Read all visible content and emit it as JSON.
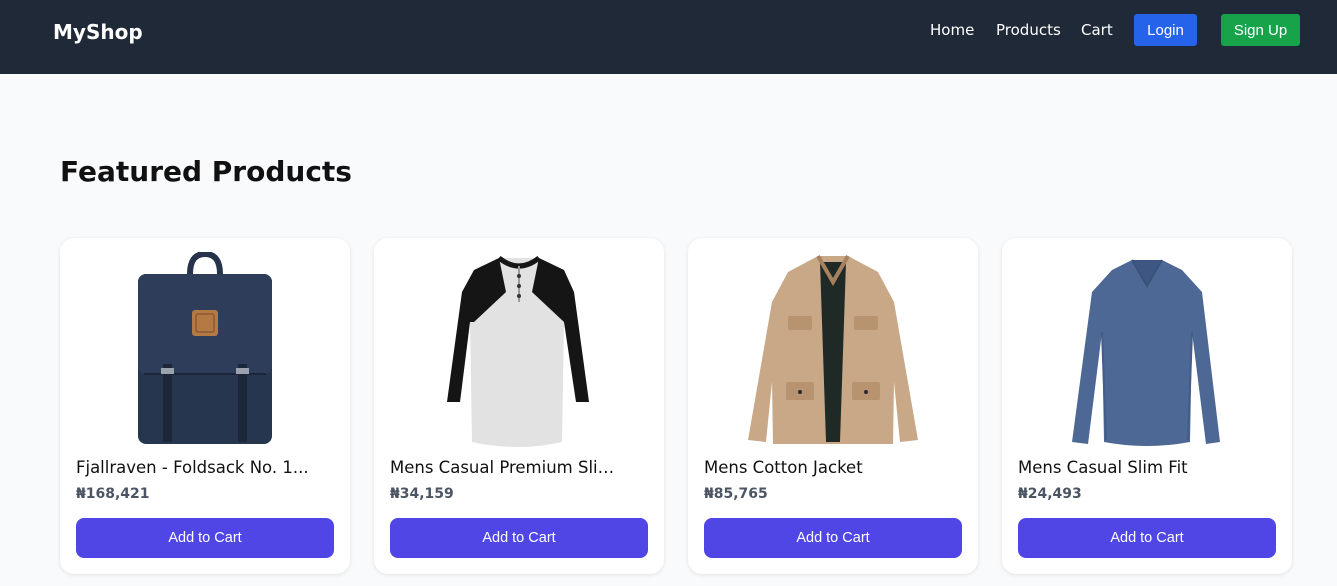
{
  "nav": {
    "brand": "MyShop",
    "links": [
      "Home",
      "Products",
      "Cart"
    ],
    "login_label": "Login",
    "signup_label": "Sign Up"
  },
  "section_title": "Featured Products",
  "products": [
    {
      "title": "Fjallraven - Foldsack No. 1...",
      "price": "₦168,421",
      "button": "Add to Cart",
      "image": "backpack-image"
    },
    {
      "title": "Mens Casual Premium Slim F...",
      "price": "₦34,159",
      "button": "Add to Cart",
      "image": "raglan-tshirt-image"
    },
    {
      "title": "Mens Cotton Jacket",
      "price": "₦85,765",
      "button": "Add to Cart",
      "image": "cotton-jacket-image"
    },
    {
      "title": "Mens Casual Slim Fit",
      "price": "₦24,493",
      "button": "Add to Cart",
      "image": "slim-fit-shirt-image"
    }
  ],
  "colors": {
    "navbar": "#1f2937",
    "login": "#2563eb",
    "signup": "#16a34a",
    "add_to_cart": "#4f46e5"
  }
}
